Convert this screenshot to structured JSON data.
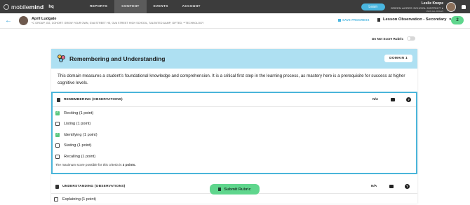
{
  "nav": {
    "brand_light": "mobile",
    "brand_bold": "mind",
    "hq": "hq",
    "items": [
      {
        "label": "REPORTS"
      },
      {
        "label": "CONTENT"
      },
      {
        "label": "EVENTS"
      },
      {
        "label": "ACCOUNT"
      }
    ],
    "active": "CONTENT",
    "learn_label": "Learn",
    "user_name": "Leslie Knope",
    "district": "GREEN ACRES SCHOOL DISTRICT",
    "district_sub": "VIEW ALL ROLES"
  },
  "subheader": {
    "student_name": "April Ludgate",
    "student_tags": "*C GROUP, GG, COHORT: GROW YOUR OWN, GVA STREET HS, GVA STREET HIGH SCHOOL, TALENTED &AMP; GIFTED, **TECHNOLOGY",
    "save_progress": "SAVE PROGRESS",
    "observation": "Lesson Observation - Secondary",
    "count": "2"
  },
  "toggle": {
    "label": "Do Not Score Rubric",
    "on": false
  },
  "domain": {
    "title": "Remembering and Understanding",
    "badge": "DOMAIN 1",
    "description": "This domain measures a student's foundational knowledge and comprehension. It is a critical first step in the learning process, as mastery here is a prerequisite for success at higher cognitive levels.",
    "header_color": "#aee0f2"
  },
  "criteria": [
    {
      "title": "REMEMBERING (OBSERVATIONS)",
      "na": "N/A",
      "help": "?",
      "options": [
        {
          "label": "Reciting (1 point)",
          "checked": true
        },
        {
          "label": "Listing (1 point)",
          "checked": false
        },
        {
          "label": "Identifying (1 point)",
          "checked": true
        },
        {
          "label": "Stating (1 point)",
          "checked": false
        },
        {
          "label": "Recalling (1 point)",
          "checked": false
        }
      ],
      "max_prefix": "The maximum score possible for this criteria is ",
      "max_value": "3 points.",
      "highlight_color": "#4ab5da"
    },
    {
      "title": "UNDERSTANDING (OBSERVATIONS)",
      "na": "N/A",
      "help": "?",
      "options": [
        {
          "label": "Explaining (1 point)",
          "checked": false
        }
      ]
    }
  ],
  "submit_label": "Submit Rubric",
  "colors": {
    "accent_blue": "#49b6e0",
    "accent_green": "#5fd68d",
    "nav_bg": "#3c3c3c"
  }
}
